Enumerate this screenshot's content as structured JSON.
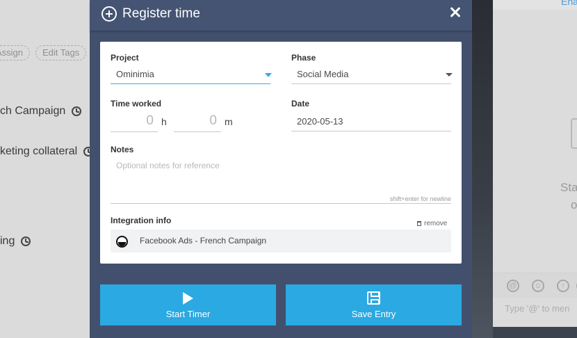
{
  "background": {
    "tags": [
      "Assign",
      "Edit Tags"
    ],
    "tasks": [
      "ch Campaign",
      "keting collateral",
      "ing"
    ],
    "right_header_link": "Ena",
    "right_text_1": "Sta",
    "right_text_2": "o",
    "right_toolbar_icons": [
      "@",
      "☺",
      "↑",
      "‹"
    ],
    "right_input_placeholder": "Type '@' to men"
  },
  "modal": {
    "title": "Register time",
    "project": {
      "label": "Project",
      "value": "Ominimia"
    },
    "phase": {
      "label": "Phase",
      "value": "Social Media"
    },
    "time_worked": {
      "label": "Time worked",
      "hours": "0",
      "hours_unit": "h",
      "minutes": "0",
      "minutes_unit": "m"
    },
    "date": {
      "label": "Date",
      "value": "2020-05-13"
    },
    "notes": {
      "label": "Notes",
      "placeholder": "Optional notes for reference",
      "hint": "shift+enter for newline"
    },
    "integration": {
      "label": "Integration info",
      "remove_label": "remove",
      "item": "Facebook Ads - French Campaign"
    },
    "buttons": {
      "start_timer": "Start Timer",
      "save_entry": "Save Entry"
    }
  },
  "colors": {
    "accent": "#2aa9e2",
    "modal_bg": "#42506e",
    "underline_active": "#3fa9e0"
  }
}
